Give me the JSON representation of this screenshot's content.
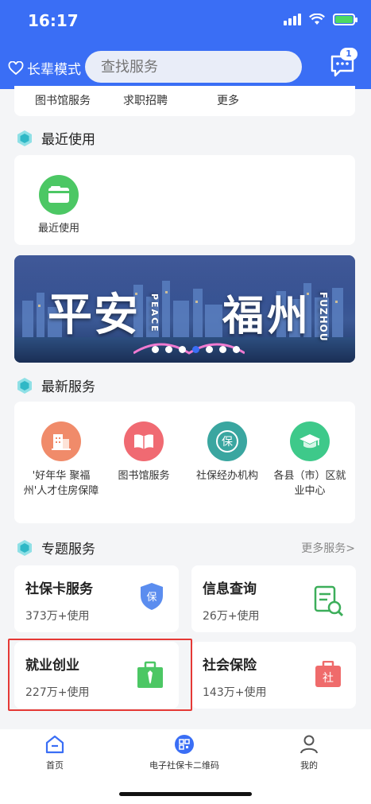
{
  "status": {
    "time": "16:17"
  },
  "header": {
    "elder_mode": "长辈模式",
    "search_placeholder": "查找服务",
    "msg_count": "1"
  },
  "top_links": [
    "图书馆服务",
    "求职招聘",
    "更多"
  ],
  "recent": {
    "title": "最近使用",
    "items": [
      {
        "label": "最近使用",
        "icon": "card-icon",
        "color": "#4cc764"
      }
    ]
  },
  "banner": {
    "main_left": "平安",
    "sub_left": "PEACE",
    "main_right": "福州",
    "sub_right": "FUZHOU",
    "dots": 7,
    "active_dot": 3
  },
  "newest": {
    "title": "最新服务",
    "items": [
      {
        "label": "'好年华 聚福州'人才住房保障",
        "icon": "building-icon",
        "color": "#f08b6a"
      },
      {
        "label": "图书馆服务",
        "icon": "book-icon",
        "color": "#f06a72"
      },
      {
        "label": "社保经办机构",
        "icon": "shield-bao-icon",
        "color": "#3aa6a0"
      },
      {
        "label": "各县（市）区就业中心",
        "icon": "graduation-cap-icon",
        "color": "#3ec98a"
      }
    ]
  },
  "topics": {
    "title": "专题服务",
    "more": "更多服务>",
    "items": [
      {
        "title": "社保卡服务",
        "count": "373万+使用",
        "icon": "shield-icon",
        "color": "#5b8def"
      },
      {
        "title": "信息查询",
        "count": "26万+使用",
        "icon": "doc-search-icon",
        "color": "#3cae5a"
      },
      {
        "title": "就业创业",
        "count": "227万+使用",
        "icon": "briefcase-icon",
        "color": "#4cc764"
      },
      {
        "title": "社会保险",
        "count": "143万+使用",
        "icon": "she-icon",
        "color": "#ef6b6b"
      }
    ]
  },
  "tabs": [
    {
      "label": "首页",
      "icon": "home-icon"
    },
    {
      "label": "电子社保卡二维码",
      "icon": "qr-code-icon"
    },
    {
      "label": "我的",
      "icon": "user-icon"
    }
  ]
}
